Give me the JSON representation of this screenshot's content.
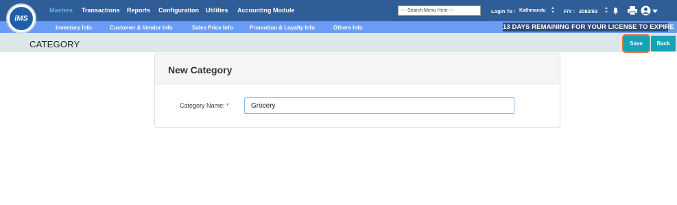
{
  "logo": {
    "text": "iMS"
  },
  "top_menu": [
    {
      "label": "Masters",
      "active": true
    },
    {
      "label": "Transactions",
      "active": false
    },
    {
      "label": "Reports",
      "active": false
    },
    {
      "label": "Configuration",
      "active": false
    },
    {
      "label": "Utilities",
      "active": false
    },
    {
      "label": "Accounting Module",
      "active": false
    }
  ],
  "search": {
    "placeholder": "--- Search Menu Here ---"
  },
  "login": {
    "label": "Login To :",
    "location": "Kathmandu"
  },
  "fiscal_year": {
    "label": "F/Y :",
    "value": "2082/83"
  },
  "icons": {
    "bell": "bell-icon",
    "print": "printer-icon",
    "user": "user-icon",
    "dropdown": "caret-down-icon"
  },
  "sub_menu": [
    {
      "label": "Inventory Info"
    },
    {
      "label": "Customer & Vendor Info"
    },
    {
      "label": "Sales Price Info"
    },
    {
      "label": "Promotion & Loyalty Info"
    },
    {
      "label": "Others Info"
    }
  ],
  "license_notice": "13 DAYS REMAINING FOR YOUR LICENSE TO EXPIRE",
  "page": {
    "title": "CATEGORY"
  },
  "actions": {
    "save_label": "Save",
    "back_label": "Back"
  },
  "form": {
    "title": "New Category",
    "category_name_label": "Category Name:",
    "required_mark": "*",
    "category_name_value": "Grocery"
  },
  "colors": {
    "topbar": "#2f5d98",
    "subbar": "#6b9cf5",
    "titlebar": "#dde7ea",
    "button": "#17a2b8",
    "highlight": "#e8712f",
    "active_menu": "#5fb3e8"
  }
}
